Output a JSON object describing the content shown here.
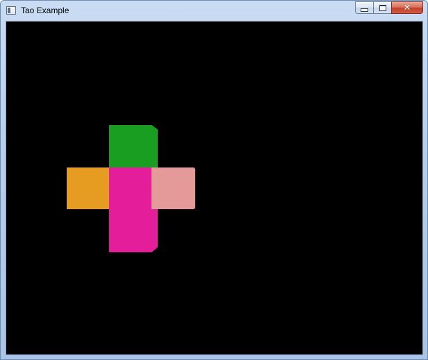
{
  "window": {
    "title": "Tao Example",
    "icon": "window-app-icon",
    "buttons": {
      "minimize_icon": "minimize-icon",
      "maximize_icon": "maximize-icon",
      "close_icon": "close-icon",
      "close_glyph": "✕"
    }
  },
  "scene": {
    "background": "#000000",
    "faces": [
      {
        "name": "cube-face-green",
        "color": "#1a9e22"
      },
      {
        "name": "cube-face-orange",
        "color": "#e69c20"
      },
      {
        "name": "cube-face-magenta",
        "color": "#e41e9b"
      },
      {
        "name": "cube-face-pink",
        "color": "#e59a9a"
      }
    ]
  }
}
